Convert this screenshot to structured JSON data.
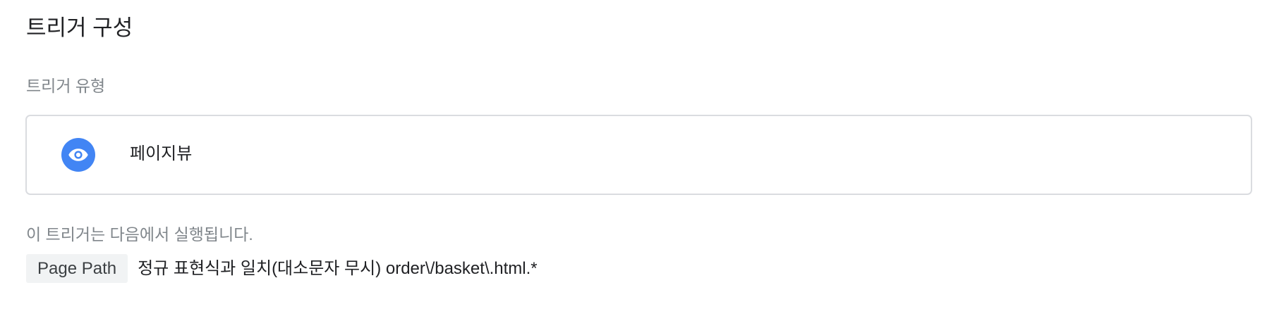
{
  "page": {
    "title": "트리거 구성"
  },
  "trigger_type": {
    "label": "트리거 유형",
    "name": "페이지뷰",
    "icon": "eye-icon",
    "icon_color": "#4285f4"
  },
  "firing": {
    "label": "이 트리거는 다음에서 실행됩니다.",
    "variable": "Page Path",
    "condition": "정규 표현식과 일치(대소문자 무시) order\\/basket\\.html.*"
  }
}
